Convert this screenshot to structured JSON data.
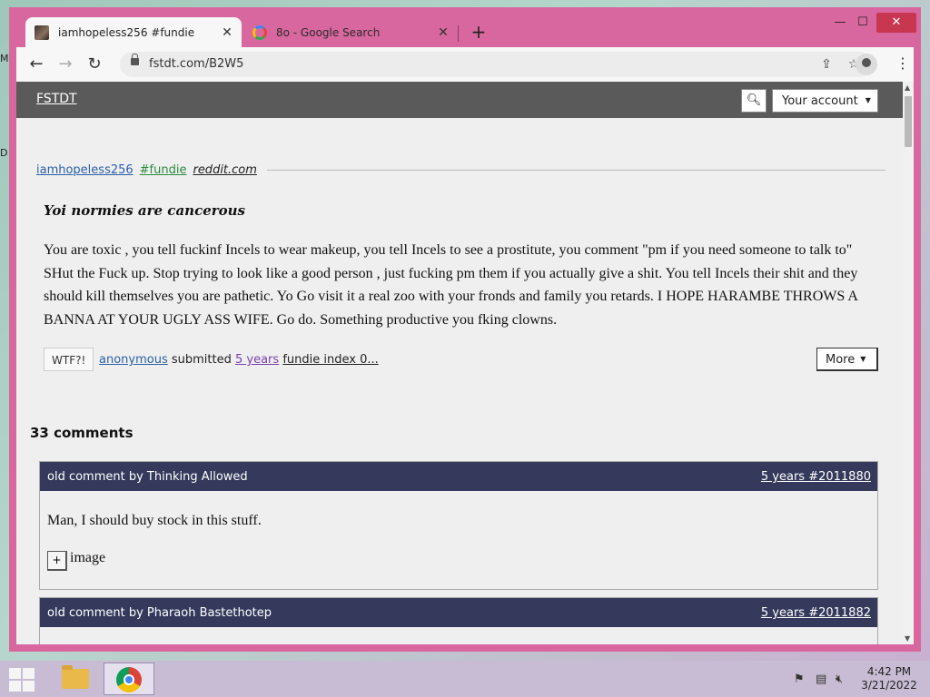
{
  "browser": {
    "tabs": [
      {
        "title": "iamhopeless256 #fundie",
        "icon": "post-thumbnail-icon"
      },
      {
        "title": "8o - Google Search",
        "icon": "google-icon"
      }
    ],
    "url": "fstdt.com/B2W5",
    "window_controls": {
      "minimize": "—",
      "maximize": "☐",
      "close": "✕"
    }
  },
  "site": {
    "logo": "FSTDT",
    "account_label": "Your account"
  },
  "post": {
    "author": "iamhopeless256",
    "tag": "#fundie",
    "source": "reddit.com",
    "title": "Yoi normies are cancerous",
    "body": "You are toxic , you tell fuckinf Incels to wear makeup, you tell Incels to see a prostitute, you comment \"pm if you need someone to talk to\" SHut the Fuck up. Stop trying to look like a good person , just fucking pm them if you actually give a shit. You tell Incels their shit and they should kill themselves you are pathetic. Yo Go visit it a real zoo with your fronds and family you retards. I HOPE HARAMBE THROWS A BANNA AT YOUR UGLY ASS WIFE. Go do. Something productive you fking clowns.",
    "wtf_label": "WTF?!",
    "submitter": "anonymous",
    "submitted_word": "submitted",
    "age": "5 years",
    "index_text": "fundie index 0...",
    "more_label": "More"
  },
  "comments": {
    "heading": "33 comments",
    "items": [
      {
        "by": "old comment by Thinking Allowed",
        "link": "5 years #2011880",
        "text": "Man, I should buy stock in this stuff.",
        "expander": "+",
        "media_label": "image"
      },
      {
        "by": "old comment by Pharaoh Bastethotep",
        "link": "5 years #2011882",
        "text": ""
      }
    ]
  },
  "taskbar": {
    "time": "4:42 PM",
    "date": "3/21/2022"
  }
}
